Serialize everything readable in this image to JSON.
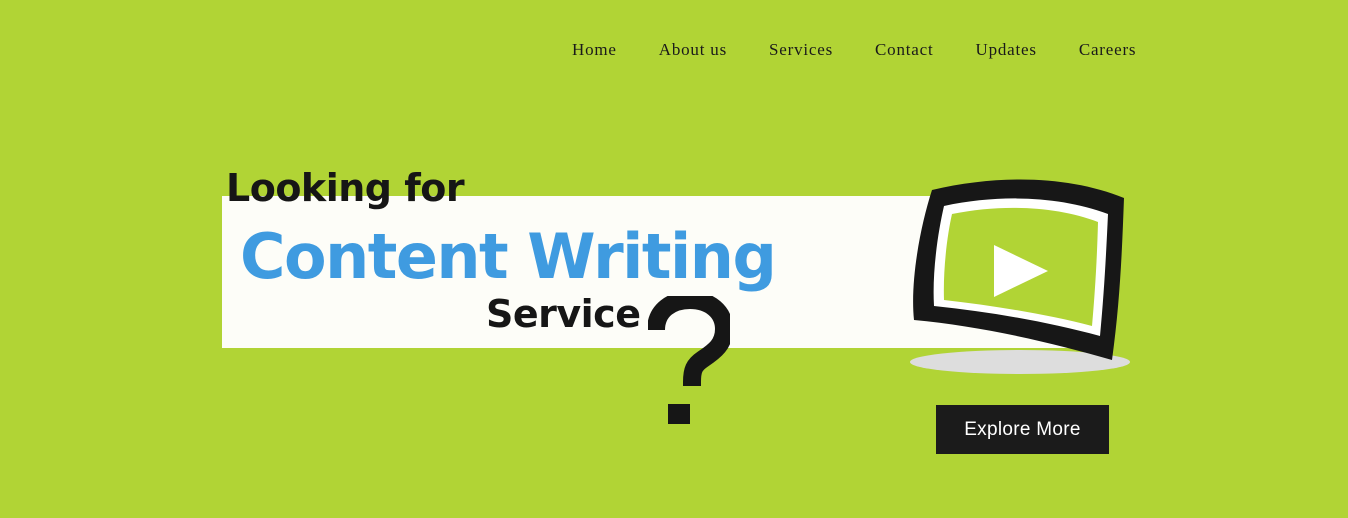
{
  "nav": {
    "items": [
      {
        "label": "Home"
      },
      {
        "label": "About us"
      },
      {
        "label": "Services"
      },
      {
        "label": "Contact"
      },
      {
        "label": "Updates"
      },
      {
        "label": "Careers"
      }
    ]
  },
  "hero": {
    "heading_top": "Looking for",
    "heading_main": "Content Writing",
    "heading_sub": "Service",
    "question_mark": "?",
    "cta_label": "Explore More"
  },
  "icons": {
    "question": "question-mark-icon",
    "video": "video-play-icon"
  },
  "colors": {
    "background": "#b1d435",
    "heading_accent": "#3f9be0",
    "band": "#fdfdf8",
    "dark": "#1b1b1b"
  }
}
